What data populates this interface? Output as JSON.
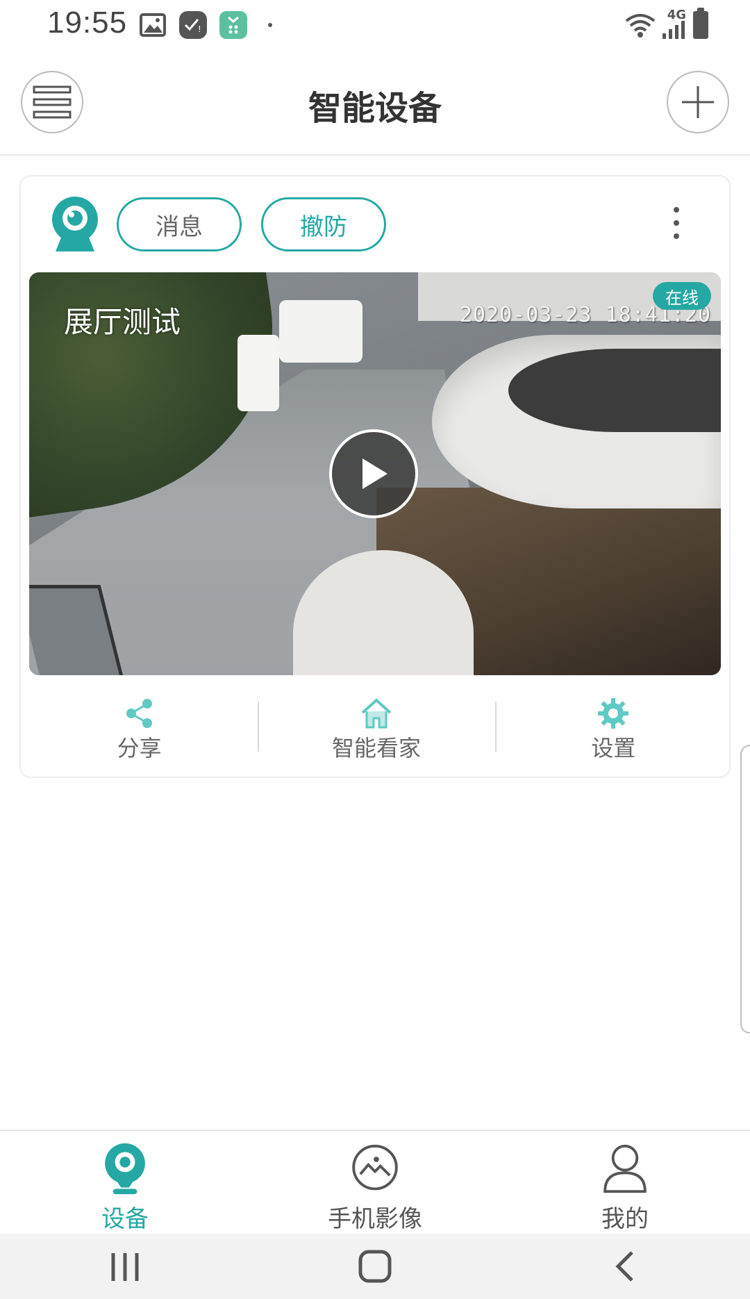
{
  "status_bar": {
    "time": "19:55",
    "icons": [
      "gallery-icon",
      "notification-icon",
      "app-icon",
      "dot-icon"
    ],
    "right_icons": [
      "wifi-icon",
      "signal-4g-icon",
      "battery-icon"
    ],
    "network_label": "4G"
  },
  "header": {
    "title": "智能设备",
    "left_icon": "menu-icon",
    "right_icon": "add-icon"
  },
  "device_card": {
    "message_button": "消息",
    "disarm_button": "撤防",
    "more_icon": "more-vertical-icon",
    "video": {
      "name": "展厅测试",
      "timestamp": "2020-03-23 18:41:20",
      "status_badge": "在线"
    },
    "actions": [
      {
        "label": "分享",
        "icon": "share-icon"
      },
      {
        "label": "智能看家",
        "icon": "home-icon"
      },
      {
        "label": "设置",
        "icon": "gear-icon"
      }
    ]
  },
  "bottom_nav": {
    "items": [
      {
        "label": "设备",
        "icon": "camera-device-icon",
        "active": true
      },
      {
        "label": "手机影像",
        "icon": "photo-icon",
        "active": false
      },
      {
        "label": "我的",
        "icon": "user-icon",
        "active": false
      }
    ]
  },
  "system_nav": [
    "recents-icon",
    "home-icon",
    "back-icon"
  ],
  "colors": {
    "accent": "#25a8a3",
    "text": "#333333",
    "muted": "#666666",
    "divider": "#e6e6e6"
  }
}
